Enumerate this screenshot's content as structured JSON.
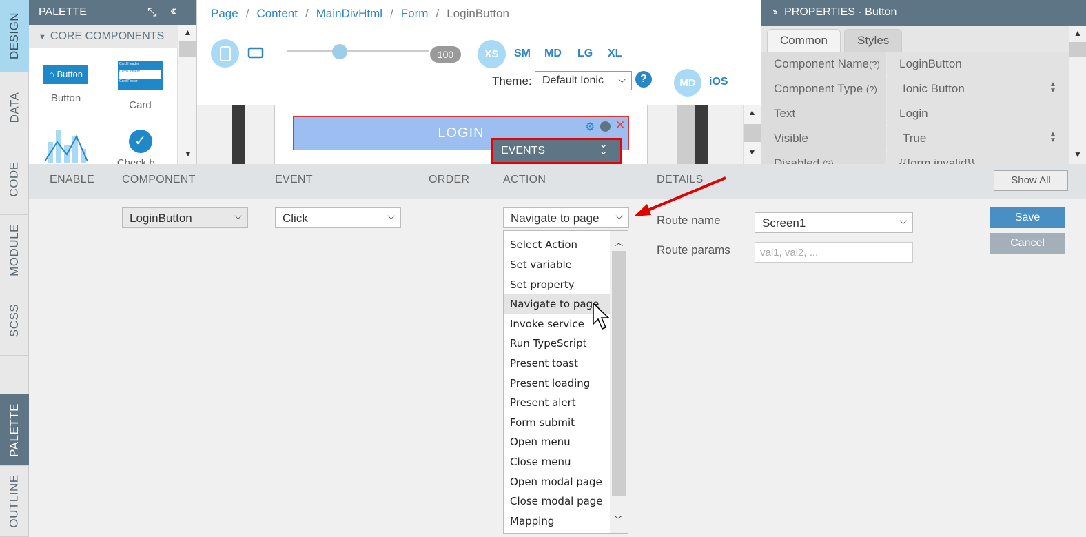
{
  "left_tabs": [
    "DESIGN",
    "DATA",
    "CODE",
    "MODULE",
    "SCSS",
    "PALETTE",
    "OUTLINE"
  ],
  "palette": {
    "title": "PALETTE",
    "section": "CORE COMPONENTS",
    "items": [
      "Button",
      "Card",
      "",
      "Check b..."
    ],
    "button_preview": "Button",
    "card_preview": [
      "Card Header",
      "Card Content",
      "Card Footer"
    ]
  },
  "breadcrumb": [
    "Page",
    "Content",
    "MainDivHtml",
    "Form",
    "LoginButton"
  ],
  "toolbar": {
    "slider_value": "100",
    "sizes": [
      "XS",
      "SM",
      "MD",
      "LG",
      "XL"
    ],
    "theme_label": "Theme:",
    "theme_value": "Default Ionic",
    "help": "?",
    "platforms": [
      "MD",
      "iOS"
    ]
  },
  "canvas": {
    "login_label": "LOGIN",
    "events_label": "EVENTS"
  },
  "properties": {
    "title": "PROPERTIES - Button",
    "tabs": [
      "Common",
      "Styles"
    ],
    "rows": [
      {
        "key": "Component Name",
        "hint": "(?)",
        "value": "LoginButton"
      },
      {
        "key": "Component Type",
        "hint": "(?)",
        "value": "Ionic Button"
      },
      {
        "key": "Text",
        "hint": "",
        "value": "Login"
      },
      {
        "key": "Visible",
        "hint": "",
        "value": "True"
      },
      {
        "key": "Disabled",
        "hint": "(?)",
        "value": "{{form.invalid}}"
      }
    ]
  },
  "events": {
    "columns": [
      "ENABLE",
      "COMPONENT",
      "EVENT",
      "ORDER",
      "ACTION",
      "DETAILS"
    ],
    "show_all": "Show All",
    "component_value": "LoginButton",
    "event_value": "Click",
    "action_value": "Navigate to page",
    "action_options": [
      "Select Action",
      "Set variable",
      "Set property",
      "Navigate to page",
      "Invoke service",
      "Run TypeScript",
      "Present toast",
      "Present loading",
      "Present alert",
      "Form submit",
      "Open menu",
      "Close menu",
      "Open modal page",
      "Close modal page",
      "Mapping"
    ],
    "highlighted_option": "Navigate to page",
    "route_name_label": "Route name",
    "route_name_value": "Screen1",
    "route_params_label": "Route params",
    "route_params_placeholder": "val1, val2, ...",
    "save_label": "Save",
    "cancel_label": "Cancel"
  },
  "colors": {
    "header": "#5e7585",
    "link": "#2b86c5",
    "save": "#4a8fc3",
    "cancel": "#a3b0ba",
    "annotation": "#e00000"
  }
}
